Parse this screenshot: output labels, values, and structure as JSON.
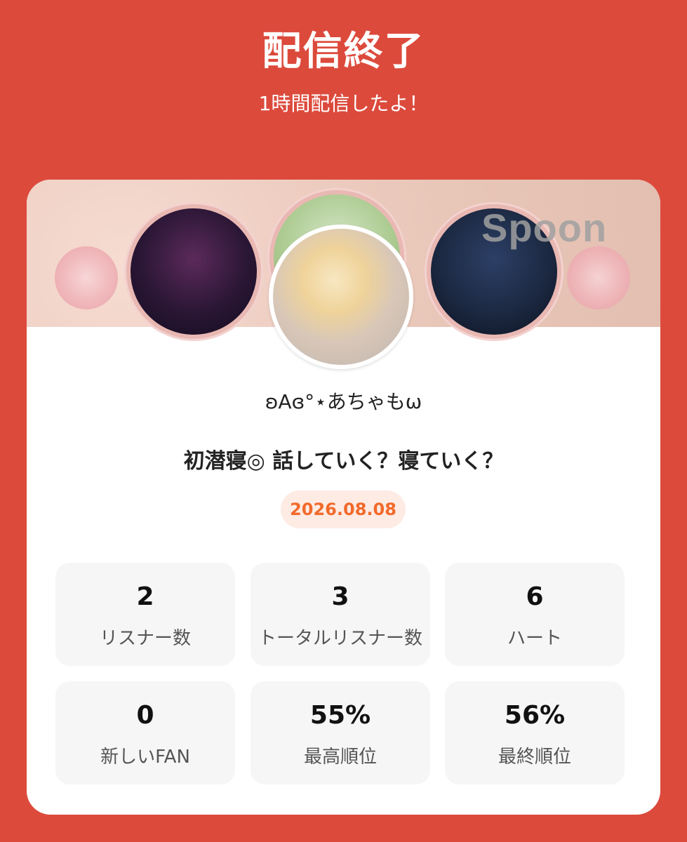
{
  "header": {
    "title": "配信終了",
    "subtitle": "1時間配信したよ！"
  },
  "card": {
    "banner_watermark": "Spoon",
    "username": "ʚAɞ°⋆あちゃもω",
    "stream_title": "初潜寝◎ 話していく？寝ていく？",
    "date": "2026.08.08",
    "stats": [
      {
        "value": "2",
        "label": "リスナー数"
      },
      {
        "value": "3",
        "label": "トータルリスナー数"
      },
      {
        "value": "6",
        "label": "ハート"
      },
      {
        "value": "0",
        "label": "新しいFAN"
      },
      {
        "value": "55%",
        "label": "最高順位"
      },
      {
        "value": "56%",
        "label": "最終順位"
      }
    ]
  },
  "colors": {
    "background": "#dc4a3c",
    "date_text": "#f26a2b",
    "date_badge_bg": "#fdebe4"
  }
}
